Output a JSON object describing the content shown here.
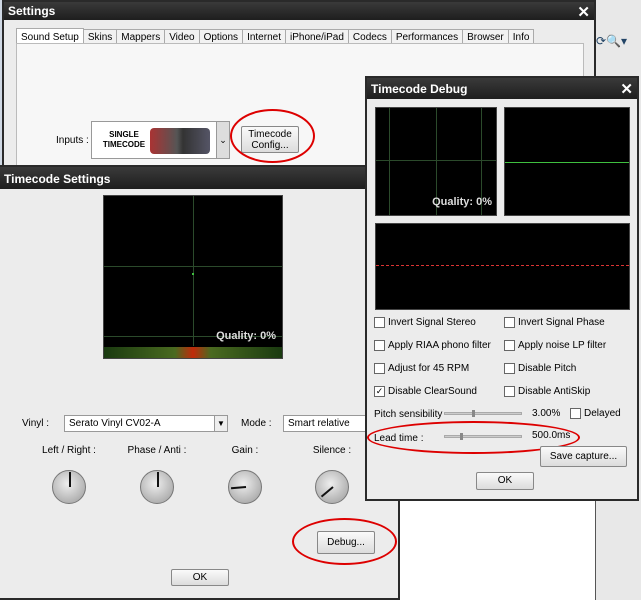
{
  "settings": {
    "title": "Settings",
    "tabs": [
      "Sound Setup",
      "Skins",
      "Mappers",
      "Video",
      "Options",
      "Internet",
      "iPhone/iPad",
      "Codecs",
      "Performances",
      "Browser",
      "Info"
    ],
    "inputs_label": "Inputs :",
    "input_image_text": "SINGLE TIMECODE",
    "timecode_config": "Timecode Config..."
  },
  "timecode_settings": {
    "title": "Timecode Settings",
    "quality": "Quality: 0%",
    "vinyl_label": "Vinyl :",
    "vinyl_value": "Serato Vinyl CV02-A",
    "mode_label": "Mode :",
    "mode_value": "Smart relative",
    "knobs": [
      {
        "label": "Left / Right :",
        "angle": 0
      },
      {
        "label": "Phase / Anti :",
        "angle": 0
      },
      {
        "label": "Gain :",
        "angle": -95
      },
      {
        "label": "Silence :",
        "angle": -130
      }
    ],
    "debug": "Debug...",
    "ok": "OK"
  },
  "debug": {
    "title": "Timecode Debug",
    "quality": "Quality: 0%",
    "checkboxes": [
      {
        "label": "Invert Signal Stereo",
        "checked": false
      },
      {
        "label": "Invert Signal Phase",
        "checked": false
      },
      {
        "label": "Apply RIAA phono filter",
        "checked": false
      },
      {
        "label": "Apply noise LP filter",
        "checked": false
      },
      {
        "label": "Adjust for 45 RPM",
        "checked": false
      },
      {
        "label": "Disable Pitch",
        "checked": false
      },
      {
        "label": "Disable ClearSound",
        "checked": true
      },
      {
        "label": "Disable AntiSkip",
        "checked": false
      }
    ],
    "pitch_label": "Pitch sensibility",
    "pitch_value": "3.00%",
    "pitch_fraction": 0.35,
    "delayed": "Delayed",
    "lead_label": "Lead time :",
    "lead_value": "500.0ms",
    "lead_fraction": 0.2,
    "save": "Save capture...",
    "ok": "OK"
  },
  "colors": {
    "highlight": "#dd0000",
    "grid": "#2b4a2b",
    "trace": "#3fbf3f"
  }
}
